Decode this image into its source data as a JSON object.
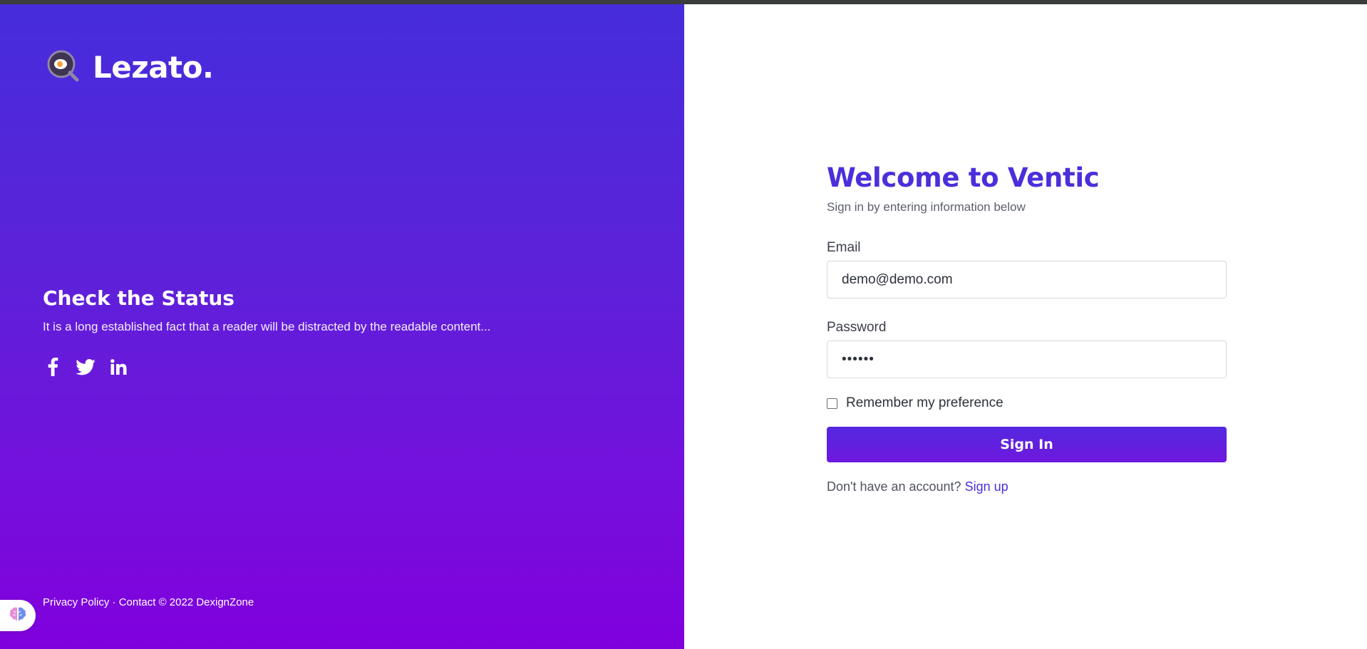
{
  "brand": {
    "name": "Lezato."
  },
  "left": {
    "status_title": "Check the Status",
    "status_text": "It is a long established fact that a reader will be distracted by the readable content...",
    "social": [
      "facebook-icon",
      "twitter-icon",
      "linkedin-icon"
    ],
    "footer": {
      "privacy": "Privacy Policy",
      "separator": "·",
      "contact": "Contact",
      "copyright": "© 2022 DexignZone"
    }
  },
  "form": {
    "title": "Welcome to Ventic",
    "subtitle": "Sign in by entering information below",
    "email_label": "Email",
    "email_value": "demo@demo.com",
    "password_label": "Password",
    "password_value": "••••••",
    "remember_label": "Remember my preference",
    "remember_checked": false,
    "signin_label": "Sign In",
    "no_account_text": "Don't have an account?",
    "signup_link": "Sign up"
  },
  "colors": {
    "accent": "#4b2fdb",
    "gradient_top": "#462ddc",
    "gradient_bottom": "#8000dd"
  }
}
